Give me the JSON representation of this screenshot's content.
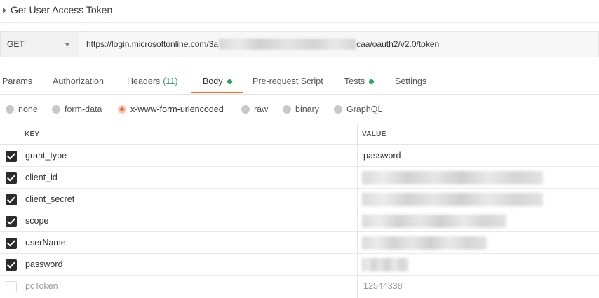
{
  "request": {
    "title": "Get User Access Token",
    "method": "GET",
    "url_prefix": "https://login.microsoftonline.com/3a",
    "url_suffix": "caa/oauth2/v2.0/token"
  },
  "tabs": [
    {
      "label": "Params"
    },
    {
      "label": "Authorization"
    },
    {
      "label": "Headers",
      "count": "(11)"
    },
    {
      "label": "Body",
      "active": true
    },
    {
      "label": "Pre-request Script"
    },
    {
      "label": "Tests"
    },
    {
      "label": "Settings"
    }
  ],
  "body_types": [
    {
      "label": "none"
    },
    {
      "label": "form-data"
    },
    {
      "label": "x-www-form-urlencoded",
      "selected": true
    },
    {
      "label": "raw"
    },
    {
      "label": "binary"
    },
    {
      "label": "GraphQL"
    }
  ],
  "table": {
    "headers": {
      "key": "KEY",
      "value": "VALUE"
    },
    "rows": [
      {
        "key": "grant_type",
        "value": "password",
        "checked": true
      },
      {
        "key": "client_id",
        "value": "",
        "checked": true
      },
      {
        "key": "client_secret",
        "value": "",
        "checked": true
      },
      {
        "key": "scope",
        "value": "",
        "checked": true
      },
      {
        "key": "userName",
        "value": "",
        "checked": true
      },
      {
        "key": "password",
        "value": "",
        "checked": true
      },
      {
        "key": "pcToken",
        "value": "12544338",
        "checked": false
      }
    ]
  },
  "colors": {
    "accent": "#f26b3a",
    "status_dot": "#26a65b"
  }
}
